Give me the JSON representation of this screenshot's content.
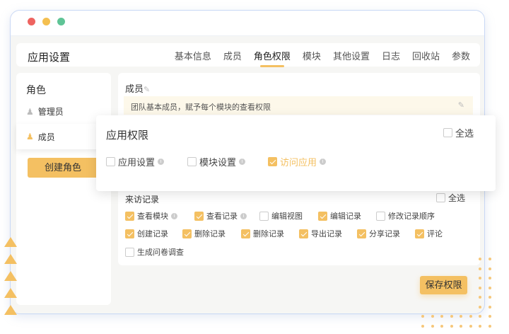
{
  "window": {
    "controls": {
      "close_color": "#ee6460",
      "min_color": "#f4bf50",
      "max_color": "#5fc496"
    }
  },
  "header": {
    "title": "应用设置",
    "tabs": [
      {
        "label": "基本信息"
      },
      {
        "label": "成员"
      },
      {
        "label": "角色权限",
        "active": true
      },
      {
        "label": "模块"
      },
      {
        "label": "其他设置"
      },
      {
        "label": "日志"
      },
      {
        "label": "回收站"
      },
      {
        "label": "参数"
      }
    ]
  },
  "sidebar": {
    "title": "角色",
    "roles": [
      {
        "label": "管理员"
      },
      {
        "label": "成员",
        "selected": true
      }
    ],
    "create_button": "创建角色"
  },
  "main": {
    "role_name": "成员",
    "description": "团队基本成员，赋予每个模块的查看权限",
    "section": {
      "title": "来访记录",
      "select_all": "全选",
      "items": [
        {
          "label": "查看模块",
          "checked": true,
          "info": true
        },
        {
          "label": "查看记录",
          "checked": true,
          "info": true
        },
        {
          "label": "编辑视图",
          "checked": false
        },
        {
          "label": "编辑记录",
          "checked": true
        },
        {
          "label": "修改记录顺序",
          "checked": false
        },
        {
          "label": "创建记录",
          "checked": true
        },
        {
          "label": "删除记录",
          "checked": true
        },
        {
          "label": "删除记录",
          "checked": true
        },
        {
          "label": "导出记录",
          "checked": true
        },
        {
          "label": "分享记录",
          "checked": true
        },
        {
          "label": "评论",
          "checked": true
        },
        {
          "label": "生成问卷调查",
          "checked": false
        }
      ]
    },
    "save_button": "保存权限"
  },
  "popup": {
    "title": "应用权限",
    "select_all": "全选",
    "items": [
      {
        "label": "应用设置",
        "checked": false
      },
      {
        "label": "模块设置",
        "checked": false
      },
      {
        "label": "访问应用",
        "checked": true
      }
    ]
  },
  "accent": "#f4c062"
}
